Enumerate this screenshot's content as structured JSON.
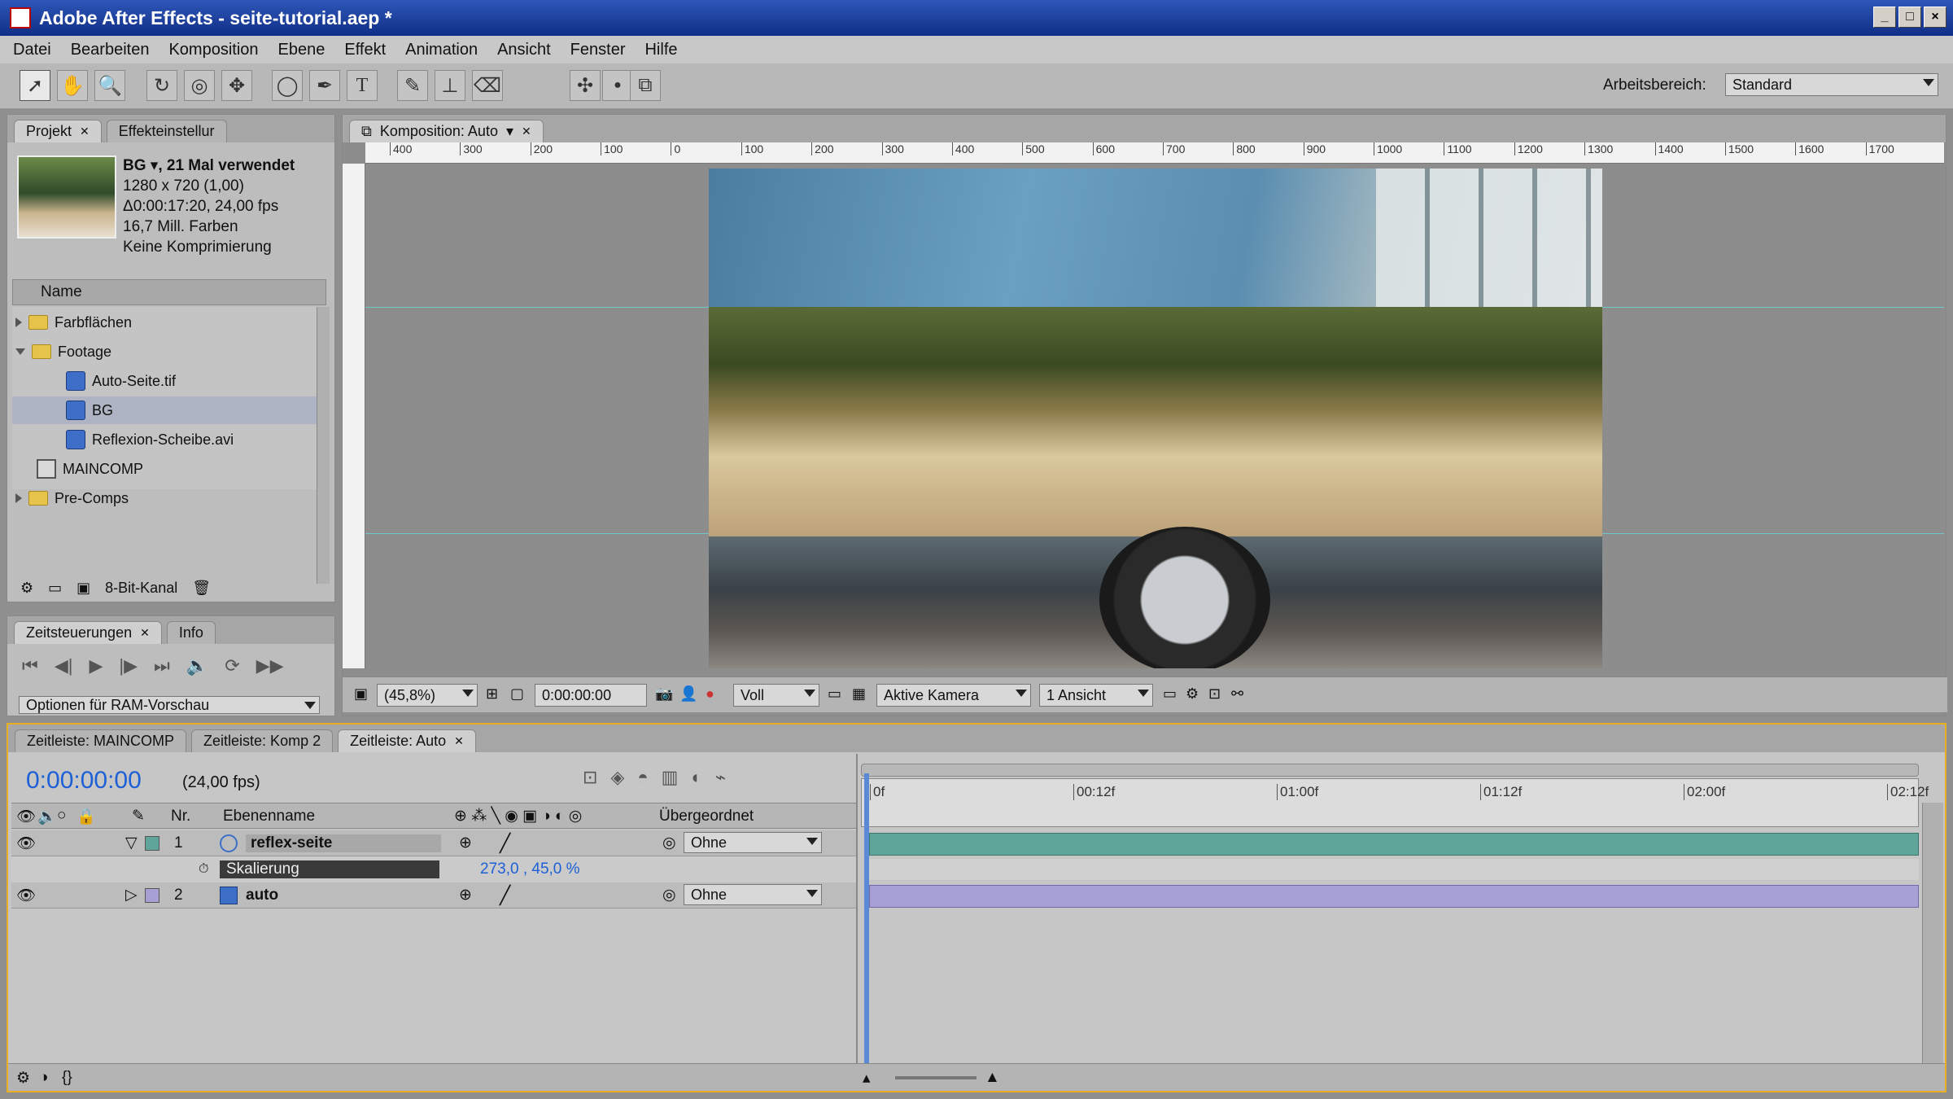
{
  "window": {
    "title": "Adobe After Effects - seite-tutorial.aep *",
    "min": "_",
    "max": "□",
    "close": "×"
  },
  "menu": [
    "Datei",
    "Bearbeiten",
    "Komposition",
    "Ebene",
    "Effekt",
    "Animation",
    "Ansicht",
    "Fenster",
    "Hilfe"
  ],
  "toolbar": {
    "tools": [
      "selection-tool",
      "hand-tool",
      "zoom-tool",
      "rotate-tool",
      "orbit-camera-tool",
      "track-xy-tool",
      "ellipse-tool",
      "pen-tool",
      "text-tool",
      "brush-tool",
      "clone-stamp-tool",
      "eraser-tool",
      "puppet-pin-tool",
      "puppet-starch-tool",
      "puppet-overlap-tool"
    ],
    "workspace_label": "Arbeitsbereich:",
    "workspace_value": "Standard"
  },
  "project_panel": {
    "tab_project": "Projekt",
    "tab_effects": "Effekteinstellur",
    "info_title": "BG ▾, 21 Mal verwendet",
    "info_lines": [
      "1280 x 720 (1,00)",
      "Δ0:00:17:20, 24,00 fps",
      "16,7 Mill. Farben",
      "Keine Komprimierung"
    ],
    "column_name": "Name",
    "items": [
      {
        "label": "Farbflächen",
        "icon": "folder-icon"
      },
      {
        "label": "Footage",
        "icon": "folder-icon"
      },
      {
        "label": "Auto-Seite.tif",
        "icon": "image-file-icon"
      },
      {
        "label": "BG",
        "icon": "footage-icon"
      },
      {
        "label": "Reflexion-Scheibe.avi",
        "icon": "footage-icon"
      },
      {
        "label": "MAINCOMP",
        "icon": "composition-icon"
      },
      {
        "label": "Pre-Comps",
        "icon": "folder-icon"
      }
    ],
    "bit_depth": "8-Bit-Kanal"
  },
  "time_controls": {
    "tab_controls": "Zeitsteuerungen",
    "tab_info": "Info",
    "ram_options": "Optionen für RAM-Vorschau"
  },
  "composition_panel": {
    "tab": "Komposition: Auto",
    "ruler_labels": [
      "400",
      "300",
      "200",
      "100",
      "0",
      "100",
      "200",
      "300",
      "400",
      "500",
      "600",
      "700",
      "800",
      "900",
      "1000",
      "1100",
      "1200",
      "1300",
      "1400",
      "1500",
      "1600",
      "1700"
    ],
    "zoom": "(45,8%)",
    "timecode": "0:00:00:00",
    "resolution": "Voll",
    "camera": "Aktive Kamera",
    "views": "1 Ansicht"
  },
  "timeline": {
    "tabs": [
      "Zeitleiste: MAINCOMP",
      "Zeitleiste: Komp 2",
      "Zeitleiste: Auto"
    ],
    "timecode": "0:00:00:00",
    "fps": "(24,00 fps)",
    "columns": {
      "nr": "Nr.",
      "layer_name": "Ebenenname",
      "parent": "Übergeordnet"
    },
    "layers": [
      {
        "nr": "1",
        "name": "reflex-seite",
        "parent": "Ohne",
        "color": "#5fa59a"
      },
      {
        "nr": "2",
        "name": "auto",
        "parent": "Ohne",
        "color": "#a6a0d4"
      }
    ],
    "property": {
      "name": "Skalierung",
      "value": "273,0 , 45,0 %"
    },
    "time_labels": [
      "0f",
      "00:12f",
      "01:00f",
      "01:12f",
      "02:00f",
      "02:12f"
    ]
  },
  "colors": {
    "accent": "#e8b020",
    "timecode": "#1c5fd6",
    "layer1": "#5fa59a",
    "layer2": "#a6a0d4"
  }
}
